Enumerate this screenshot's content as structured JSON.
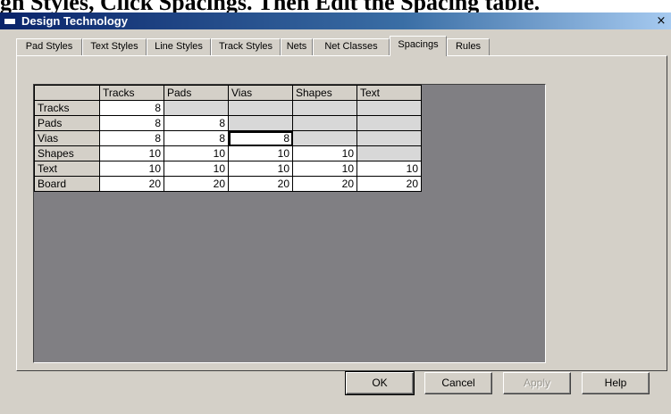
{
  "background_caption": "gn Styles, Click Spacings. Then Edit the Spacing table.",
  "window": {
    "title": "Design Technology",
    "close_label": "×"
  },
  "tabs": [
    {
      "label": "Pad Styles"
    },
    {
      "label": "Text Styles"
    },
    {
      "label": "Line Styles"
    },
    {
      "label": "Track Styles"
    },
    {
      "label": "Nets"
    },
    {
      "label": "Net Classes"
    },
    {
      "label": "Spacings",
      "active": true
    },
    {
      "label": "Rules"
    }
  ],
  "spacing_table": {
    "columns": [
      "Tracks",
      "Pads",
      "Vias",
      "Shapes",
      "Text"
    ],
    "rows": [
      {
        "label": "Tracks",
        "cells": [
          "8",
          "",
          "",
          "",
          ""
        ]
      },
      {
        "label": "Pads",
        "cells": [
          "8",
          "8",
          "",
          "",
          ""
        ]
      },
      {
        "label": "Vias",
        "cells": [
          "8",
          "8",
          "8",
          "",
          ""
        ]
      },
      {
        "label": "Shapes",
        "cells": [
          "10",
          "10",
          "10",
          "10",
          ""
        ]
      },
      {
        "label": "Text",
        "cells": [
          "10",
          "10",
          "10",
          "10",
          "10"
        ]
      },
      {
        "label": "Board",
        "cells": [
          "20",
          "20",
          "20",
          "20",
          "20"
        ]
      }
    ],
    "selected_cell": {
      "row": "Vias",
      "column": "Vias"
    }
  },
  "buttons": {
    "ok": "OK",
    "cancel": "Cancel",
    "apply": "Apply",
    "help": "Help"
  },
  "colors": {
    "titlebar_start": "#0a246a",
    "dialog_face": "#d4d0c8",
    "grid_background": "#807f83"
  }
}
